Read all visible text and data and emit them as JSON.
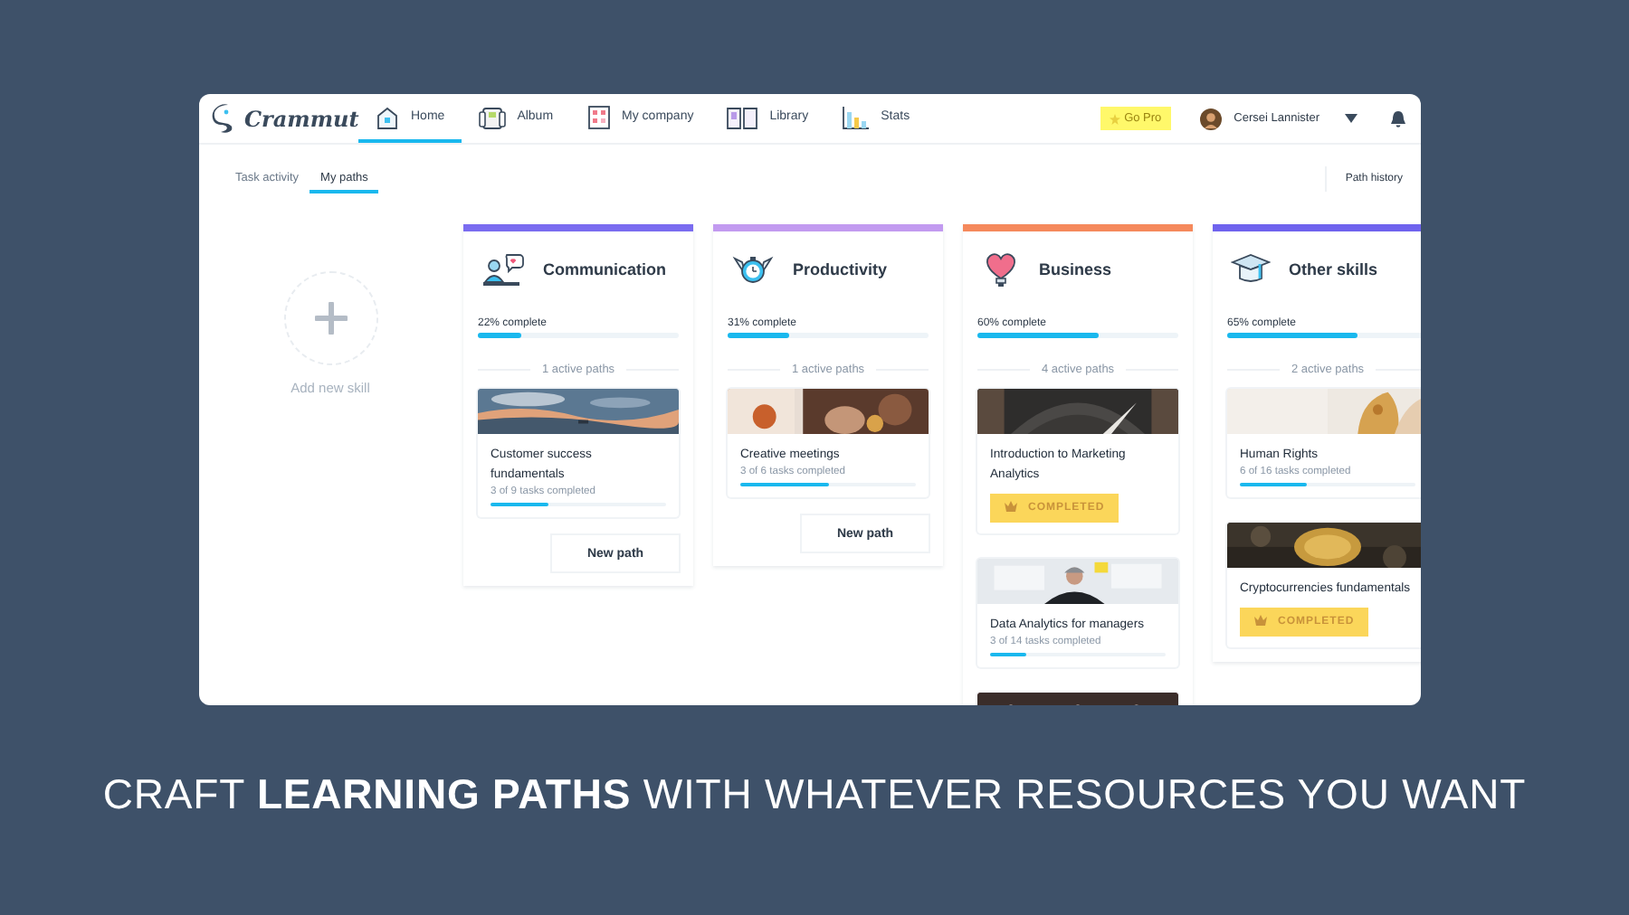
{
  "brand": {
    "name": "Crammut"
  },
  "nav": [
    {
      "kind": "home",
      "label": "Home",
      "selected": true
    },
    {
      "kind": "album",
      "label": "Album",
      "selected": false
    },
    {
      "kind": "company",
      "label": "My company",
      "selected": false
    },
    {
      "kind": "library",
      "label": "Library",
      "selected": false
    },
    {
      "kind": "stats",
      "label": "Stats",
      "selected": false
    }
  ],
  "go_pro": {
    "label": "Go Pro"
  },
  "user": {
    "name": "Cersei Lannister"
  },
  "subtabs": [
    {
      "label": "Task activity",
      "selected": false
    },
    {
      "label": "My paths",
      "selected": true
    }
  ],
  "path_history": {
    "label": "Path history"
  },
  "add_skill": {
    "label": "Add new skill"
  },
  "columns": [
    {
      "name": "Communication",
      "kind": "communication",
      "color": "#7a6cf0",
      "level": 0.22,
      "progress": "22% complete",
      "active": "1 active paths",
      "new_path": "New path",
      "paths": [
        {
          "kind": "path",
          "title": "Customer success fundamentals",
          "tasks": "3 of 9 tasks completed",
          "level": 0.33,
          "completed": false
        }
      ]
    },
    {
      "name": "Productivity",
      "kind": "productivity",
      "color": "#c29af0",
      "level": 0.31,
      "progress": "31% complete",
      "active": "1 active paths",
      "new_path": "New path",
      "paths": [
        {
          "kind": "path",
          "title": "Creative meetings",
          "tasks": "3 of 6 tasks completed",
          "level": 0.5,
          "completed": false
        }
      ]
    },
    {
      "name": "Business",
      "kind": "business",
      "color": "#f5895c",
      "level": 0.6,
      "progress": "60% complete",
      "active": "4 active paths",
      "paths": [
        {
          "kind": "path",
          "title": "Introduction to Marketing Analytics",
          "badge": "COMPLETED",
          "completed": true
        },
        {
          "kind": "path",
          "title": "Data Analytics for managers",
          "tasks": "3 of 14 tasks completed",
          "level": 0.21,
          "completed": false
        },
        {
          "kind": "picture"
        }
      ]
    },
    {
      "name": "Other skills",
      "kind": "other",
      "color": "#6f63ee",
      "level": 0.65,
      "progress": "65% complete",
      "active": "2 active paths",
      "paths": [
        {
          "kind": "path",
          "title": "Human Rights",
          "tasks": "6 of 16 tasks completed",
          "level": 0.38,
          "completed": false
        },
        {
          "kind": "path",
          "title": "Cryptocurrencies fundamentals",
          "badge": "COMPLETED",
          "completed": true
        }
      ]
    }
  ],
  "caption": "CRAFT **LEARNING PATHS** WITH WHATEVER RESOURCES YOU WANT"
}
